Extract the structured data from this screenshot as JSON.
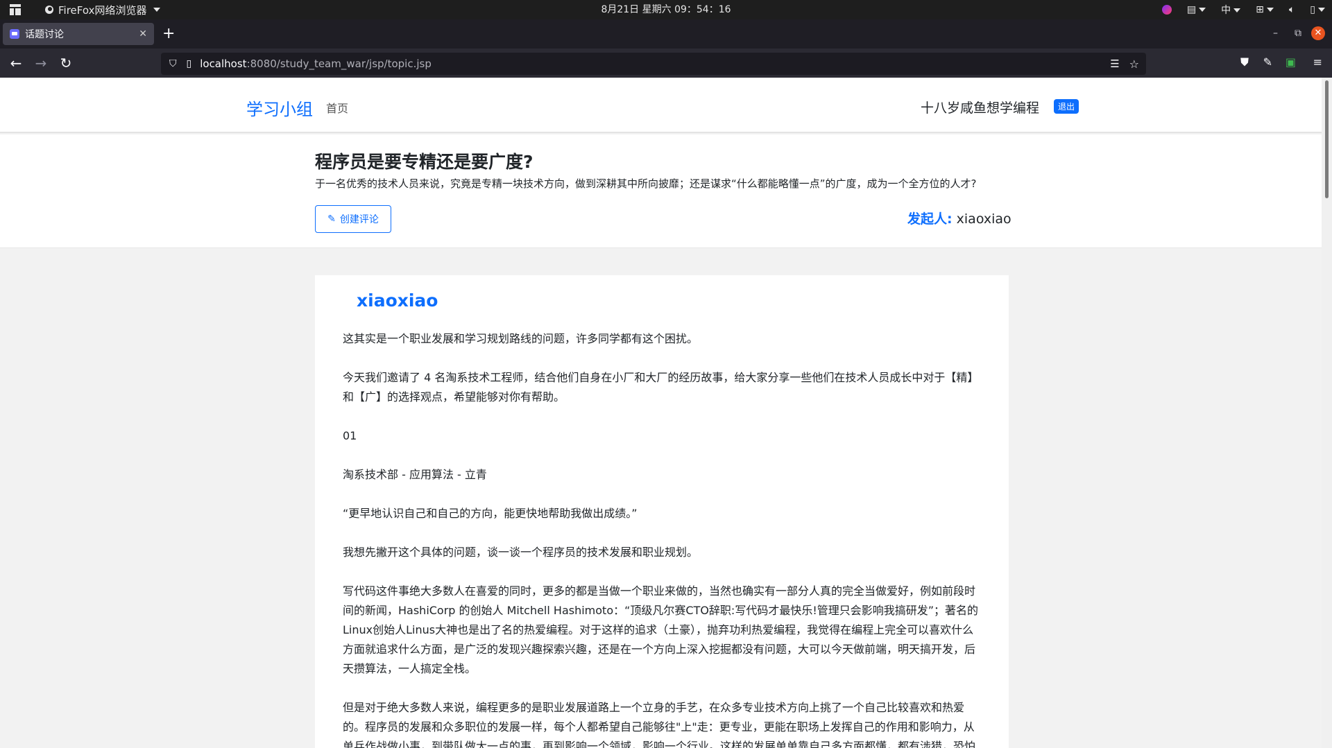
{
  "os": {
    "app_name": "FireFox网络浏览器",
    "clock": "8月21日 星期六  09：54：16",
    "ime": "中"
  },
  "browser": {
    "tab_title": "话题讨论",
    "url_host": "localhost",
    "url_path": ":8080/study_team_war/jsp/topic.jsp"
  },
  "header": {
    "brand": "学习小组",
    "nav_home": "首页",
    "username": "十八岁咸鱼想学编程",
    "logout": "退出"
  },
  "topic": {
    "title": "程序员是要专精还是要广度?",
    "description": "于一名优秀的技术人员来说，究竟是专精一块技术方向，做到深耕其中所向披靡；还是谋求“什么都能略懂一点”的广度，成为一个全方位的人才?",
    "comment_button": "创建评论",
    "creator_label": "发起人:",
    "creator_name": "xiaoxiao"
  },
  "comment": {
    "author": "xiaoxiao",
    "paragraphs": [
      "这其实是一个职业发展和学习规划路线的问题，许多同学都有这个困扰。",
      "今天我们邀请了 4 名淘系技术工程师，结合他们自身在小厂和大厂的经历故事，给大家分享一些他们在技术人员成长中对于【精】和【广】的选择观点，希望能够对你有帮助。",
      "01",
      "淘系技术部 - 应用算法 - 立青",
      "“更早地认识自己和自己的方向，能更快地帮助我做出成绩。”",
      "我想先撇开这个具体的问题，谈一谈一个程序员的技术发展和职业规划。",
      "写代码这件事绝大多数人在喜爱的同时，更多的都是当做一个职业来做的，当然也确实有一部分人真的完全当做爱好，例如前段时间的新闻，HashiCorp 的创始人 Mitchell Hashimoto：“顶级凡尔赛CTO辞职:写代码才最快乐!管理只会影响我搞研发”；著名的Linux创始人Linus大神也是出了名的热爱编程。对于这样的追求（土豪），抛弃功利热爱编程，我觉得在编程上完全可以喜欢什么方面就追求什么方面，是广泛的发现兴趣探索兴趣，还是在一个方向上深入挖掘都没有问题，大可以今天做前端，明天搞开发，后天攒算法，一人搞定全栈。",
      "但是对于绝大多数人来说，编程更多的是职业发展道路上一个立身的手艺，在众多专业技术方向上挑了一个自己比较喜欢和热爱的。程序员的发展和众多职位的发展一样，每个人都希望自己能够往\"上\"走：更专业，更能在职场上发挥自己的作用和影响力，从单兵作战做小事，到带队做大一点的事，再到影响一个领域，影响一个行业。这样的发展单单靠自己多方面都懂，都有涉猎，恐怕"
    ]
  }
}
